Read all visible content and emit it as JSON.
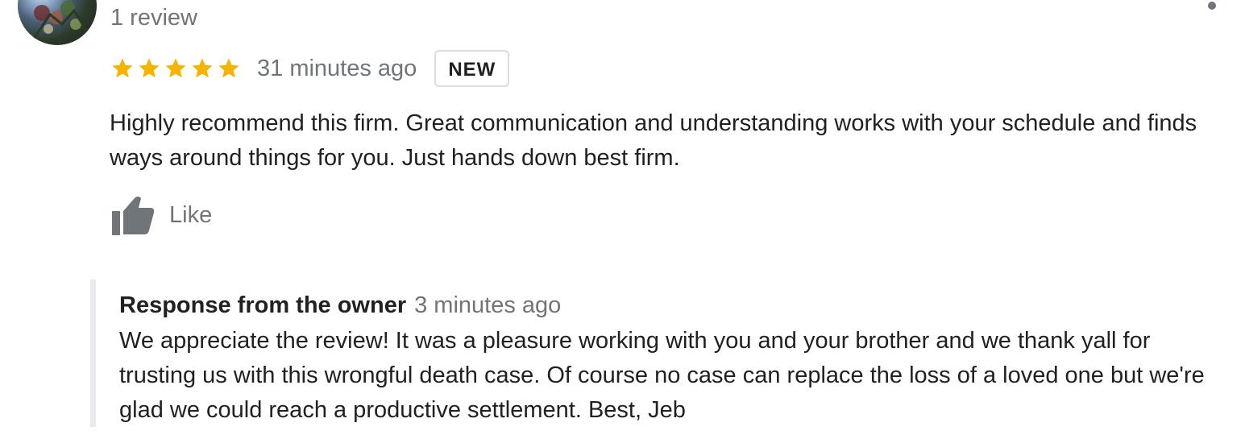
{
  "reviewer": {
    "review_count": "1 review"
  },
  "review": {
    "rating": 5,
    "max_rating": 5,
    "time": "31 minutes ago",
    "badge": "NEW",
    "text": "Highly recommend this firm. Great communication and understanding works with your schedule and finds ways around things for you. Just hands down best firm.",
    "like_label": "Like",
    "like_icon": "thumbs-up-icon",
    "more_icon": "more-options-icon"
  },
  "owner_response": {
    "title": "Response from the owner",
    "time": "3 minutes ago",
    "text": "We appreciate the review! It was a pleasure working with you and your brother and we thank yall for trusting us with this wrongful death case. Of course no case can replace the loss of a loved one but we're glad we could reach a productive settlement. Best, Jeb"
  },
  "colors": {
    "star": "#f4b400",
    "secondary_text": "#70757a",
    "primary_text": "#202124",
    "badge_border": "#dadce0",
    "response_border": "#e8eaed"
  }
}
